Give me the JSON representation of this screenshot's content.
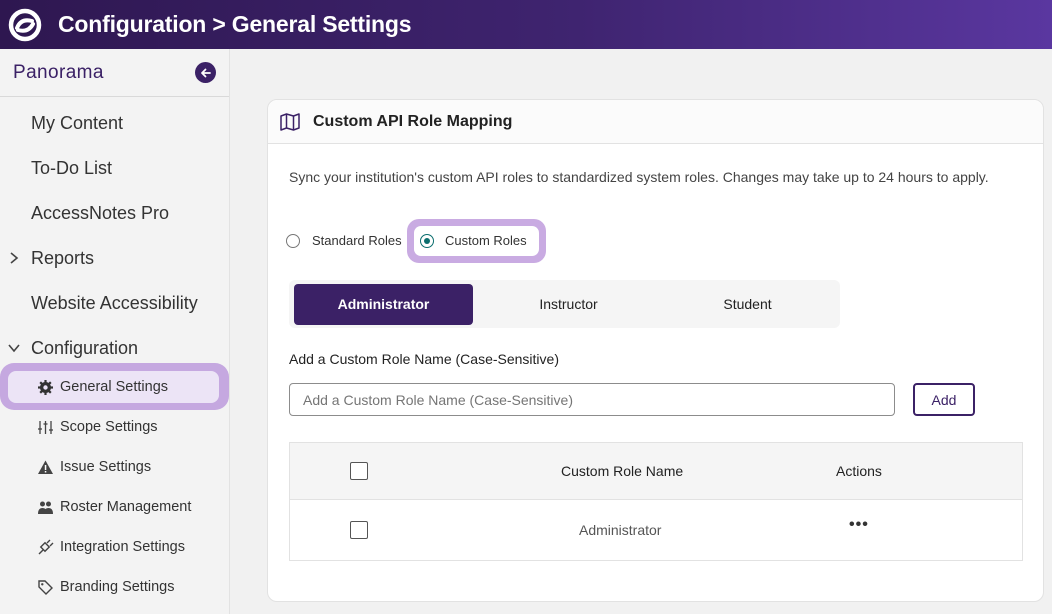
{
  "topbar": {
    "title": "Configuration > General Settings"
  },
  "sidebar": {
    "brand": "Panorama",
    "items": [
      {
        "label": "My Content"
      },
      {
        "label": "To-Do List"
      },
      {
        "label": "AccessNotes Pro"
      },
      {
        "label": "Reports"
      },
      {
        "label": "Website Accessibility"
      },
      {
        "label": "Configuration"
      }
    ],
    "sub_items": [
      {
        "label": "General Settings",
        "icon": "gear-icon"
      },
      {
        "label": "Scope Settings",
        "icon": "sliders-icon"
      },
      {
        "label": "Issue Settings",
        "icon": "warning-icon"
      },
      {
        "label": "Roster Management",
        "icon": "users-icon"
      },
      {
        "label": "Integration Settings",
        "icon": "plug-icon"
      },
      {
        "label": "Branding Settings",
        "icon": "tag-icon"
      }
    ]
  },
  "card": {
    "title": "Custom API Role Mapping",
    "description": "Sync your institution's custom API roles to standardized system roles. Changes may take up to 24 hours to apply.",
    "radios": [
      {
        "label": "Standard Roles",
        "selected": false
      },
      {
        "label": "Custom Roles",
        "selected": true
      }
    ],
    "tabs": [
      {
        "label": "Administrator",
        "active": true
      },
      {
        "label": "Instructor",
        "active": false
      },
      {
        "label": "Student",
        "active": false
      }
    ],
    "field_label": "Add a Custom Role Name (Case-Sensitive)",
    "input_placeholder": "Add a Custom Role Name (Case-Sensitive)",
    "add_button": "Add",
    "table": {
      "headers": {
        "name": "Custom Role Name",
        "actions": "Actions"
      },
      "rows": [
        {
          "name": "Administrator",
          "actions": "•••"
        }
      ]
    }
  },
  "colors": {
    "brand_purple": "#3b2166",
    "highlight": "#c5a8e0",
    "radio_teal": "#0b6e6e"
  }
}
